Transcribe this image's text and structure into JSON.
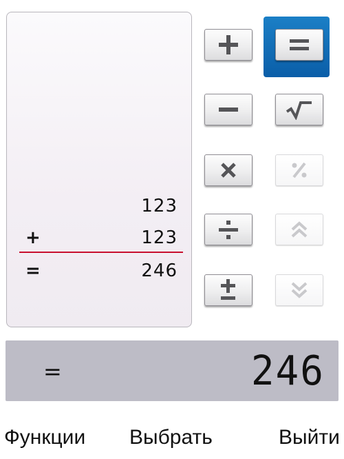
{
  "tape": {
    "row1_num": "123",
    "row2_op": "+",
    "row2_num": "123",
    "row3_op": "=",
    "row3_num": "246"
  },
  "result": {
    "operator": "=",
    "value": "246"
  },
  "keys": {
    "plus": {
      "icon": "plus-icon",
      "enabled": true
    },
    "minus": {
      "icon": "minus-icon",
      "enabled": true
    },
    "multiply": {
      "icon": "multiply-icon",
      "enabled": true
    },
    "divide": {
      "icon": "divide-icon",
      "enabled": true
    },
    "plus_minus": {
      "icon": "plus-minus-icon",
      "enabled": true
    },
    "equals": {
      "icon": "equals-icon",
      "enabled": true,
      "focused": true
    },
    "sqrt": {
      "icon": "square-root-icon",
      "enabled": true
    },
    "percent": {
      "icon": "percent-icon",
      "enabled": false
    },
    "scroll_up": {
      "icon": "double-chevron-up-icon",
      "enabled": false
    },
    "scroll_down": {
      "icon": "double-chevron-down-icon",
      "enabled": false
    }
  },
  "softkeys": {
    "left": "Функции",
    "middle": "Выбрать",
    "right": "Выйти"
  },
  "colors": {
    "focus": "#0a6ab3",
    "tape_line": "#c8102e",
    "result_bg": "#bdbcc6"
  }
}
